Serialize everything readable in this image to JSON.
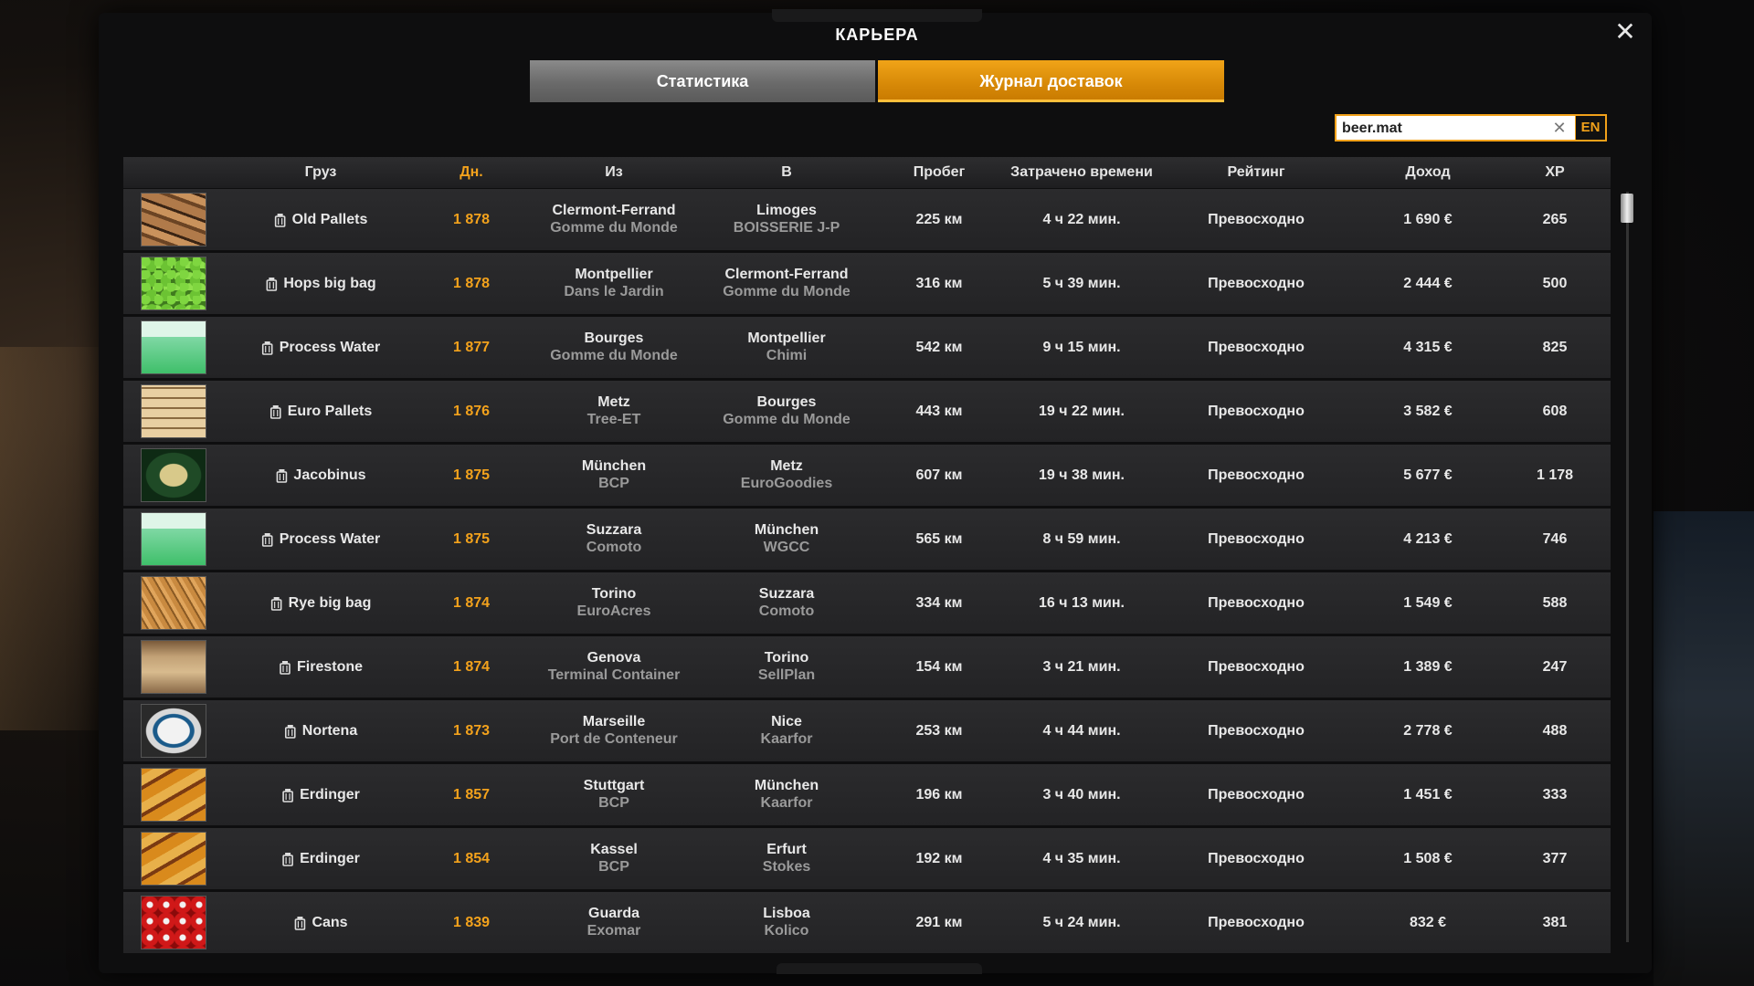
{
  "window": {
    "title": "КАРЬЕРА"
  },
  "tabs": [
    {
      "label": "Статистика",
      "active": false
    },
    {
      "label": "Журнал доставок",
      "active": true
    }
  ],
  "search": {
    "value": "beer.mat",
    "lang": "EN"
  },
  "columns": {
    "cargo": "Груз",
    "days": "Дн.",
    "from": "Из",
    "to": "В",
    "distance": "Пробег",
    "time": "Затрачено времени",
    "rating": "Рейтинг",
    "income": "Доход",
    "xp": "XP"
  },
  "colors": {
    "accent": "#f3a21c",
    "row_bg": "#2b2b2d",
    "header_bg": "#2d2d2f"
  },
  "rows": [
    {
      "cargo": "Old Pallets",
      "icon": "old-pallets",
      "days": "1 878",
      "from_city": "Clermont-Ferrand",
      "from_company": "Gomme du Monde",
      "to_city": "Limoges",
      "to_company": "BOISSERIE J-P",
      "distance": "225 км",
      "time": "4 ч 22 мин.",
      "rating": "Превосходно",
      "income": "1 690 €",
      "xp": "265"
    },
    {
      "cargo": "Hops big bag",
      "icon": "hops",
      "days": "1 878",
      "from_city": "Montpellier",
      "from_company": "Dans le Jardin",
      "to_city": "Clermont-Ferrand",
      "to_company": "Gomme du Monde",
      "distance": "316 км",
      "time": "5 ч 39 мин.",
      "rating": "Превосходно",
      "income": "2 444 €",
      "xp": "500"
    },
    {
      "cargo": "Process Water",
      "icon": "water",
      "days": "1 877",
      "from_city": "Bourges",
      "from_company": "Gomme du Monde",
      "to_city": "Montpellier",
      "to_company": "Chimi",
      "distance": "542 км",
      "time": "9 ч 15 мин.",
      "rating": "Превосходно",
      "income": "4 315 €",
      "xp": "825"
    },
    {
      "cargo": "Euro Pallets",
      "icon": "euro-pallets",
      "days": "1 876",
      "from_city": "Metz",
      "from_company": "Tree-ET",
      "to_city": "Bourges",
      "to_company": "Gomme du Monde",
      "distance": "443 км",
      "time": "19 ч 22 мин.",
      "rating": "Превосходно",
      "income": "3 582 €",
      "xp": "608"
    },
    {
      "cargo": "Jacobinus",
      "icon": "jacobinus",
      "days": "1 875",
      "from_city": "München",
      "from_company": "BCP",
      "to_city": "Metz",
      "to_company": "EuroGoodies",
      "distance": "607 км",
      "time": "19 ч 38 мин.",
      "rating": "Превосходно",
      "income": "5 677 €",
      "xp": "1 178"
    },
    {
      "cargo": "Process Water",
      "icon": "water",
      "days": "1 875",
      "from_city": "Suzzara",
      "from_company": "Comoto",
      "to_city": "München",
      "to_company": "WGCC",
      "distance": "565 км",
      "time": "8 ч 59 мин.",
      "rating": "Превосходно",
      "income": "4 213 €",
      "xp": "746"
    },
    {
      "cargo": "Rye big bag",
      "icon": "rye",
      "days": "1 874",
      "from_city": "Torino",
      "from_company": "EuroAcres",
      "to_city": "Suzzara",
      "to_company": "Comoto",
      "distance": "334 км",
      "time": "16 ч 13 мин.",
      "rating": "Превосходно",
      "income": "1 549 €",
      "xp": "588"
    },
    {
      "cargo": "Firestone",
      "icon": "firestone",
      "days": "1 874",
      "from_city": "Genova",
      "from_company": "Terminal Container",
      "to_city": "Torino",
      "to_company": "SellPlan",
      "distance": "154 км",
      "time": "3 ч 21 мин.",
      "rating": "Превосходно",
      "income": "1 389 €",
      "xp": "247"
    },
    {
      "cargo": "Nortena",
      "icon": "nortena",
      "days": "1 873",
      "from_city": "Marseille",
      "from_company": "Port de Conteneur",
      "to_city": "Nice",
      "to_company": "Kaarfor",
      "distance": "253 км",
      "time": "4 ч 44 мин.",
      "rating": "Превосходно",
      "income": "2 778 €",
      "xp": "488"
    },
    {
      "cargo": "Erdinger",
      "icon": "erdinger",
      "days": "1 857",
      "from_city": "Stuttgart",
      "from_company": "BCP",
      "to_city": "München",
      "to_company": "Kaarfor",
      "distance": "196 км",
      "time": "3 ч 40 мин.",
      "rating": "Превосходно",
      "income": "1 451 €",
      "xp": "333"
    },
    {
      "cargo": "Erdinger",
      "icon": "erdinger",
      "days": "1 854",
      "from_city": "Kassel",
      "from_company": "BCP",
      "to_city": "Erfurt",
      "to_company": "Stokes",
      "distance": "192 км",
      "time": "4 ч 35 мин.",
      "rating": "Превосходно",
      "income": "1 508 €",
      "xp": "377"
    },
    {
      "cargo": "Cans",
      "icon": "cans",
      "days": "1 839",
      "from_city": "Guarda",
      "from_company": "Exomar",
      "to_city": "Lisboa",
      "to_company": "Kolico",
      "distance": "291 км",
      "time": "5 ч 24 мин.",
      "rating": "Превосходно",
      "income": "832 €",
      "xp": "381"
    }
  ]
}
